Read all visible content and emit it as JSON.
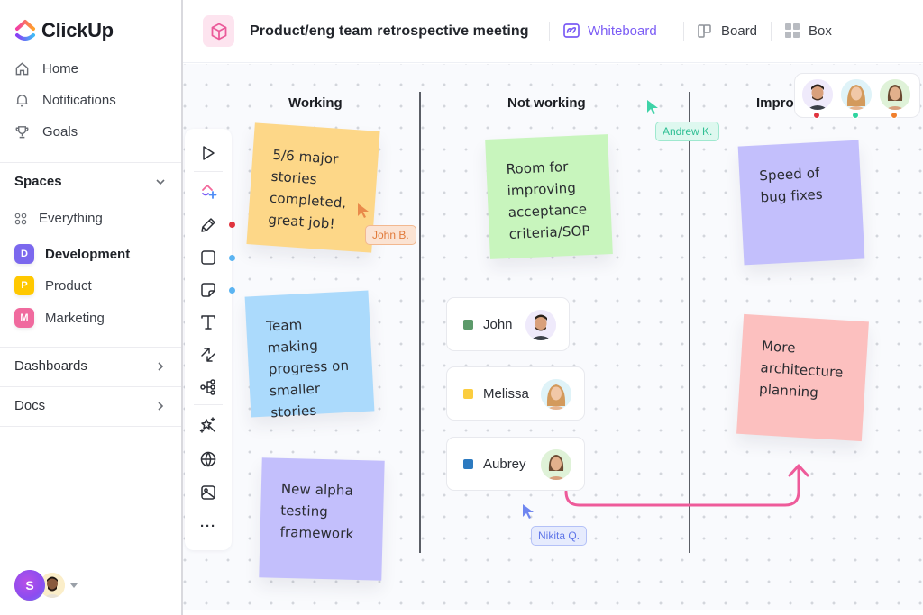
{
  "brand": {
    "name": "ClickUp"
  },
  "sidebar": {
    "nav": [
      {
        "label": "Home",
        "icon": "home-icon"
      },
      {
        "label": "Notifications",
        "icon": "bell-icon"
      },
      {
        "label": "Goals",
        "icon": "trophy-icon"
      }
    ],
    "spaces": {
      "heading": "Spaces",
      "everything_label": "Everything",
      "items": [
        {
          "letter": "D",
          "label": "Development",
          "color": "#7b68ee",
          "active": true
        },
        {
          "letter": "P",
          "label": "Product",
          "color": "#ffc800",
          "active": false
        },
        {
          "letter": "M",
          "label": "Marketing",
          "color": "#f06a9e",
          "active": false
        }
      ]
    },
    "dashboards_label": "Dashboards",
    "docs_label": "Docs",
    "user": {
      "initial": "S"
    }
  },
  "header": {
    "title": "Product/eng team retrospective meeting",
    "views": [
      {
        "label": "Whiteboard",
        "active": true
      },
      {
        "label": "Board",
        "active": false
      },
      {
        "label": "Box",
        "active": false
      }
    ],
    "accent": "#7b5cf5"
  },
  "whiteboard": {
    "columns": [
      {
        "title": "Working"
      },
      {
        "title": "Not working"
      },
      {
        "title": "Impro"
      }
    ],
    "stickies": [
      {
        "text": "5/6 major\nstories\ncompleted,\ngreat job!",
        "color": "#fdd788",
        "column": "Working"
      },
      {
        "text": "Team making\nprogress on\nsmaller\nstories",
        "color": "#abdafc",
        "column": "Working"
      },
      {
        "text": "New alpha\ntesting\nframework",
        "color": "#c3bffc",
        "column": "Working"
      },
      {
        "text": "Room for\nimproving\nacceptance\ncriteria/SOP",
        "color": "#c8f5bd",
        "column": "Not working"
      },
      {
        "text": "Speed of\nbug fixes",
        "color": "#c3bffc",
        "column": "Improve"
      },
      {
        "text": "More\narchitecture\nplanning",
        "color": "#fcc0bf",
        "column": "Improve"
      }
    ],
    "people": [
      {
        "name": "John",
        "swatch": "#5c9a6a"
      },
      {
        "name": "Melissa",
        "swatch": "#fbcd3f"
      },
      {
        "name": "Aubrey",
        "swatch": "#2c7ac0"
      }
    ],
    "cursors": [
      {
        "name": "John B.",
        "color": "#e98a4a"
      },
      {
        "name": "Andrew K.",
        "color": "#3fd3a8"
      },
      {
        "name": "Nikita Q.",
        "color": "#6f86f0"
      }
    ],
    "collaborators": [
      {
        "status_color": "#e0343f"
      },
      {
        "status_color": "#2fd4a0"
      },
      {
        "status_color": "#f07f2c"
      }
    ],
    "connector_color": "#ee5b9a",
    "toolbar_tools": [
      "select",
      "clickup-ai",
      "pen",
      "shape",
      "sticky-note",
      "text",
      "connector",
      "mind-map",
      "magic",
      "embed",
      "image",
      "more"
    ],
    "more_label": "···"
  }
}
